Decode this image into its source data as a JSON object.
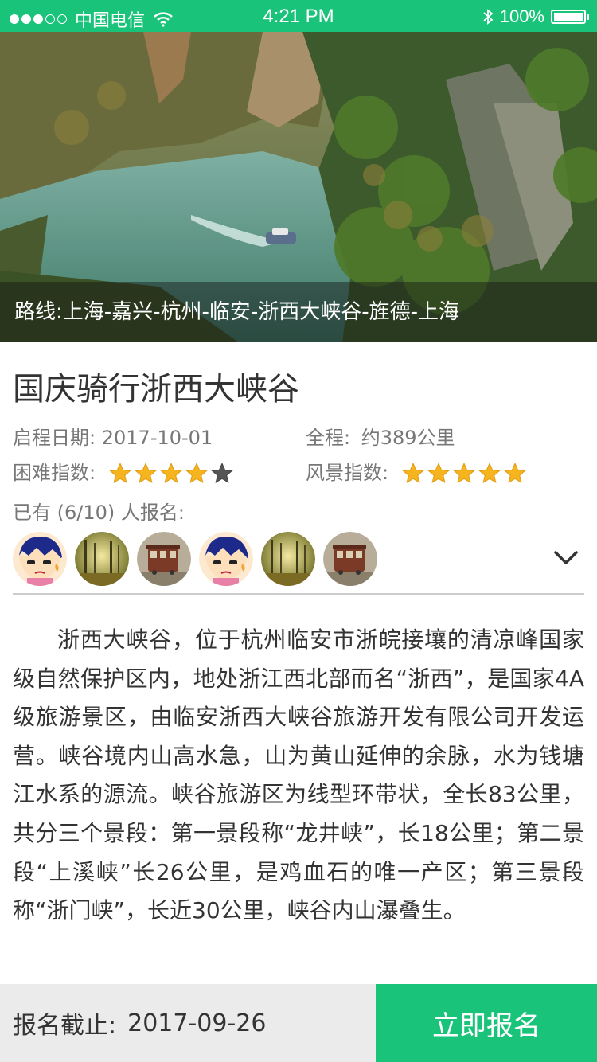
{
  "status_bar": {
    "carrier": "中国电信",
    "time": "4:21 PM",
    "battery": "100%",
    "signal_icon": "signal-dots-icon",
    "wifi_icon": "wifi-icon",
    "bluetooth_icon": "bluetooth-icon",
    "battery_icon": "battery-icon"
  },
  "hero": {
    "route": "路线:上海-嘉兴-杭州-临安-浙西大峡谷-旌德-上海"
  },
  "event": {
    "title": "国庆骑行浙西大峡谷",
    "start_label": "启程日期:",
    "start_date": "2017-10-01",
    "distance_label": "全程:",
    "distance_value": "约389公里",
    "difficulty_label": "困难指数:",
    "difficulty_rating": 4,
    "scenery_label": "风景指数:",
    "scenery_rating": 5,
    "joined_text": "已有 (6/10) 人报名:",
    "avatars": [
      "cartoon-boy-avatar",
      "forest-avatar",
      "tram-avatar",
      "cartoon-boy-avatar",
      "forest-avatar",
      "tram-avatar"
    ],
    "expand_icon": "chevron-down-icon"
  },
  "description": "浙西大峡谷，位于杭州临安市浙皖接壤的清凉峰国家级自然保护区内，地处浙江西北部而名“浙西”，是国家4A级旅游景区，由临安浙西大峡谷旅游开发有限公司开发运营。峡谷境内山高水急，山为黄山延伸的余脉，水为钱塘江水系的源流。峡谷旅游区为线型环带状，全长83公里，共分三个景段：第一景段称“龙井峡”，长18公里；第二景段“上溪峡”长26公里，是鸡血石的唯一产区；第三景段称“浙门峡”，长近30公里，峡谷内山瀑叠生。",
  "footer": {
    "deadline_label": "报名截止:",
    "deadline_date": "2017-09-26",
    "signup_button": "立即报名"
  },
  "colors": {
    "accent": "#19c37a",
    "star_gold": "#f6b51e",
    "star_gray": "#555555"
  }
}
